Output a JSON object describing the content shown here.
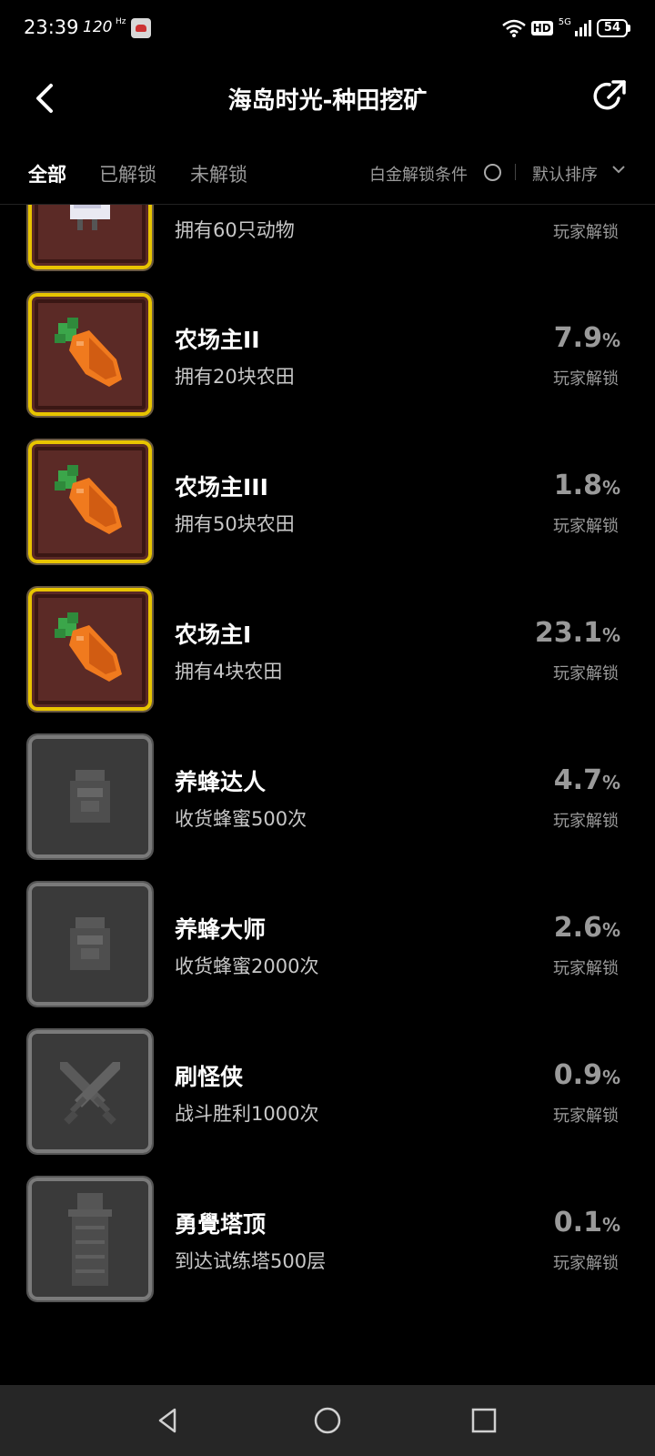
{
  "status": {
    "time": "23:39",
    "refresh": "120",
    "refresh_unit": "Hz",
    "network": "5G",
    "hd": "HD",
    "battery": "54"
  },
  "header": {
    "title": "海岛时光-种田挖矿"
  },
  "tabs": [
    {
      "label": "全部",
      "active": true
    },
    {
      "label": "已解锁",
      "active": false
    },
    {
      "label": "未解锁",
      "active": false
    }
  ],
  "filters": {
    "platinum_label": "白金解锁条件",
    "sort_label": "默认排序"
  },
  "achievements": [
    {
      "name": "",
      "desc": "拥有60只动物",
      "pct": "",
      "pct_unit": "",
      "label": "玩家解锁",
      "unlocked": true,
      "icon": "chicken-icon"
    },
    {
      "name": "农场主II",
      "desc": "拥有20块农田",
      "pct": "7.9",
      "pct_unit": "%",
      "label": "玩家解锁",
      "unlocked": true,
      "icon": "carrot-icon"
    },
    {
      "name": "农场主III",
      "desc": "拥有50块农田",
      "pct": "1.8",
      "pct_unit": "%",
      "label": "玩家解锁",
      "unlocked": true,
      "icon": "carrot-icon"
    },
    {
      "name": "农场主I",
      "desc": "拥有4块农田",
      "pct": "23.1",
      "pct_unit": "%",
      "label": "玩家解锁",
      "unlocked": true,
      "icon": "carrot-icon"
    },
    {
      "name": "养蜂达人",
      "desc": "收货蜂蜜500次",
      "pct": "4.7",
      "pct_unit": "%",
      "label": "玩家解锁",
      "unlocked": false,
      "icon": "honey-jar-icon"
    },
    {
      "name": "养蜂大师",
      "desc": "收货蜂蜜2000次",
      "pct": "2.6",
      "pct_unit": "%",
      "label": "玩家解锁",
      "unlocked": false,
      "icon": "honey-jar-icon"
    },
    {
      "name": "刷怪侠",
      "desc": "战斗胜利1000次",
      "pct": "0.9",
      "pct_unit": "%",
      "label": "玩家解锁",
      "unlocked": false,
      "icon": "crossed-swords-icon"
    },
    {
      "name": "勇覺塔顶",
      "desc": "到达试练塔500层",
      "pct": "0.1",
      "pct_unit": "%",
      "label": "玩家解锁",
      "unlocked": false,
      "icon": "tower-icon"
    }
  ]
}
